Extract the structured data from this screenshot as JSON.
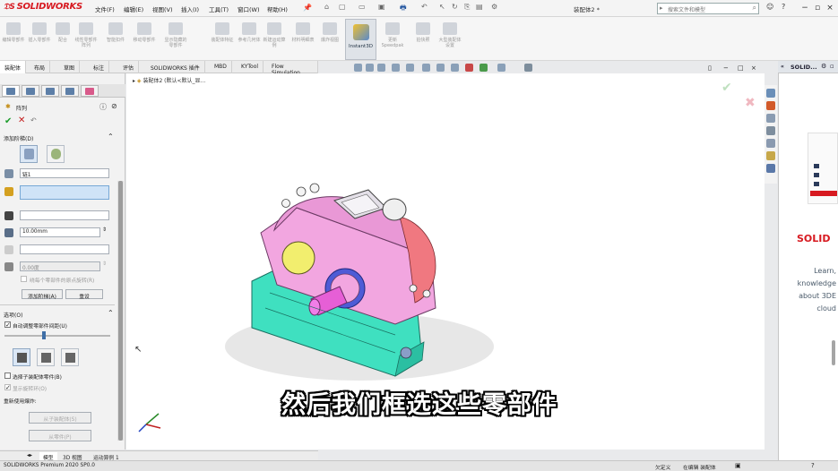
{
  "app": {
    "name": "SOLIDWORKS",
    "document_title": "装配体2 *",
    "menu": [
      "文件(F)",
      "编辑(E)",
      "视图(V)",
      "插入(I)",
      "工具(T)",
      "窗口(W)",
      "帮助(H)"
    ],
    "search_placeholder": "搜索文件和模型"
  },
  "command_manager": {
    "items": [
      "编辑零部件",
      "插入零部件",
      "配合",
      "线性零部件阵列",
      "智能扣件",
      "移动零部件",
      "显示隐藏的零部件",
      "装配体特征",
      "参考几何体",
      "新建运动算例",
      "材料明细表",
      "爆炸视图",
      "Instant3D",
      "更新Speedpak",
      "拍快照",
      "大型装配体设置"
    ],
    "instant3d_label": "Instant3D",
    "speedpak_label": "Speedpak"
  },
  "tabs": [
    "装配体",
    "布局",
    "草图",
    "标注",
    "评估",
    "SOLIDWORKS 插件",
    "MBD",
    "KYTool",
    "Flow Simulation"
  ],
  "tree": {
    "crumb": "装配体2 (默认<默认_显..."
  },
  "property_manager": {
    "title": "阵列",
    "section_add_steps": "添加阶梯(D)",
    "step_name_value": "链1",
    "distance_value": "10.00mm",
    "angle_value": "0.00度",
    "checkbox_rotate_origin": "绕每个零部件的原点旋转(R)",
    "btn_add_step": "添加阶梯(A)",
    "btn_reset": "重设",
    "section_options": "选项(O)",
    "checkbox_auto_adjust": "自动调整零部件间距(U)",
    "checkbox_select_subassembly": "选择子装配体零件(B)",
    "checkbox_show_rotation": "显示旋转环(O)",
    "reuse_explode_label": "重新使用爆炸:",
    "btn_from_subassembly": "从子装配体(S)",
    "btn_from_part": "从零件(P)"
  },
  "bottom_tabs": [
    "模型",
    "3D 视图",
    "运动算例 1"
  ],
  "status": {
    "version": "SOLIDWORKS Premium 2020 SP0.0",
    "custom": "欠定义",
    "editing": "在编辑 装配体"
  },
  "task_pane": {
    "title": "SOLID...",
    "brand": "SOLID",
    "learn_lines": [
      "Learn,",
      "knowledge",
      "about 3DE",
      "cloud"
    ]
  },
  "subtitle": "然后我们框选这些零部件",
  "colors": {
    "brand_red": "#d71920",
    "gear_pink": "#f2a6e0",
    "gear_cyan": "#3fe0c0",
    "shaft_magenta": "#e65fd6",
    "boss_yellow": "#f2ee6e",
    "ring_blue": "#4e5bd6"
  }
}
